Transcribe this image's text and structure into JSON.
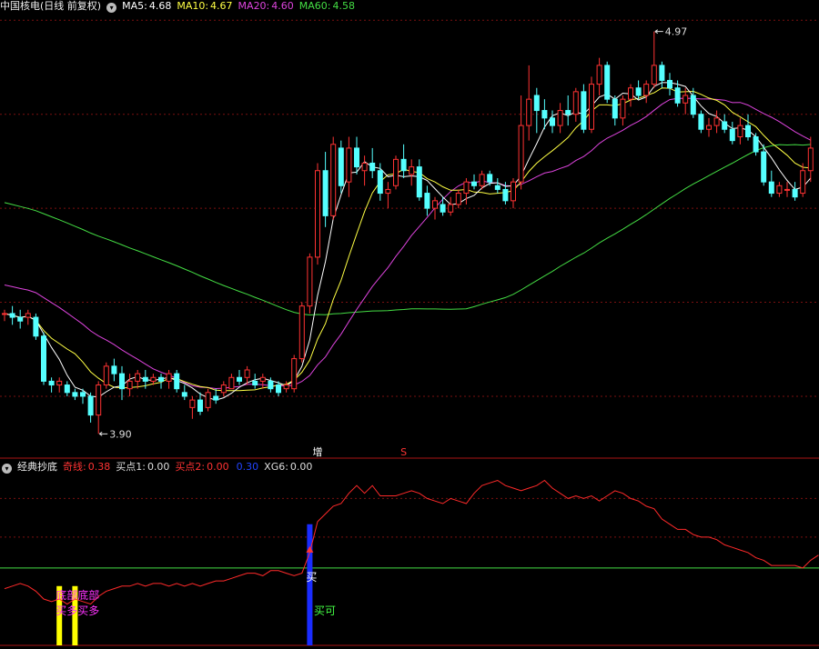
{
  "main_header": {
    "title": "中国核电(日线 前复权)",
    "items": [
      {
        "label": "MA5:",
        "value": "4.68",
        "color": "#ffffff"
      },
      {
        "label": "MA10:",
        "value": "4.67",
        "color": "#ffff44"
      },
      {
        "label": "MA20:",
        "value": "4.60",
        "color": "#dd44dd"
      },
      {
        "label": "MA60:",
        "value": "4.58",
        "color": "#44dd44"
      }
    ]
  },
  "sub_header": {
    "title": "经典抄底",
    "items": [
      {
        "label": "奇线:",
        "value": "0.38",
        "color": "#ff3333"
      },
      {
        "label": "买点1:",
        "value": "0.00",
        "color": "#dddddd"
      },
      {
        "label": "买点2:",
        "value": "0.00",
        "color": "#ff3333"
      },
      {
        "label": "",
        "value": "0.30",
        "color": "#2244ff"
      },
      {
        "label": "XG6:",
        "value": "0.00",
        "color": "#dddddd"
      }
    ]
  },
  "colors": {
    "up": "#ff3333",
    "down": "#55ffff",
    "ma5": "#ffffff",
    "ma10": "#ffff44",
    "ma20": "#dd44dd",
    "ma60": "#44dd44",
    "grid": "#7a1010"
  },
  "chart_data": {
    "type": "candlestick",
    "candles": [
      [
        4.22,
        4.23,
        4.2,
        4.22
      ],
      [
        4.22,
        4.24,
        4.19,
        4.21
      ],
      [
        4.21,
        4.23,
        4.18,
        4.2
      ],
      [
        4.21,
        4.23,
        4.19,
        4.22
      ],
      [
        4.21,
        4.22,
        4.15,
        4.16
      ],
      [
        4.16,
        4.17,
        4.03,
        4.04
      ],
      [
        4.04,
        4.05,
        4.01,
        4.03
      ],
      [
        4.03,
        4.05,
        4.01,
        4.04
      ],
      [
        4.03,
        4.04,
        4.0,
        4.01
      ],
      [
        4.01,
        4.02,
        3.99,
        4.0
      ],
      [
        4.01,
        4.02,
        3.98,
        4.0
      ],
      [
        4.0,
        4.01,
        3.93,
        3.95
      ],
      [
        3.95,
        4.04,
        3.9,
        4.03
      ],
      [
        4.03,
        4.09,
        4.02,
        4.08
      ],
      [
        4.08,
        4.1,
        4.04,
        4.06
      ],
      [
        4.06,
        4.08,
        3.99,
        4.02
      ],
      [
        4.02,
        4.06,
        4.0,
        4.04
      ],
      [
        4.04,
        4.07,
        4.02,
        4.06
      ],
      [
        4.05,
        4.07,
        4.02,
        4.04
      ],
      [
        4.04,
        4.06,
        4.03,
        4.05
      ],
      [
        4.05,
        4.06,
        4.02,
        4.04
      ],
      [
        4.04,
        4.07,
        4.02,
        4.06
      ],
      [
        4.06,
        4.07,
        4.01,
        4.02
      ],
      [
        4.01,
        4.03,
        3.99,
        4.0
      ],
      [
        3.97,
        4.0,
        3.94,
        3.99
      ],
      [
        3.99,
        4.01,
        3.95,
        3.96
      ],
      [
        3.97,
        4.02,
        3.96,
        4.01
      ],
      [
        4.0,
        4.02,
        3.98,
        3.99
      ],
      [
        4.01,
        4.04,
        4.0,
        4.03
      ],
      [
        4.02,
        4.06,
        4.02,
        4.05
      ],
      [
        4.05,
        4.07,
        4.03,
        4.04
      ],
      [
        4.05,
        4.08,
        4.03,
        4.07
      ],
      [
        4.04,
        4.06,
        4.02,
        4.03
      ],
      [
        4.04,
        4.06,
        4.02,
        4.05
      ],
      [
        4.04,
        4.05,
        4.01,
        4.02
      ],
      [
        4.03,
        4.04,
        4.0,
        4.01
      ],
      [
        4.02,
        4.04,
        4.01,
        4.03
      ],
      [
        4.02,
        4.11,
        4.01,
        4.1
      ],
      [
        4.1,
        4.25,
        4.09,
        4.24
      ],
      [
        4.24,
        4.38,
        4.22,
        4.37
      ],
      [
        4.37,
        4.62,
        4.35,
        4.6
      ],
      [
        4.6,
        4.65,
        4.45,
        4.48
      ],
      [
        4.48,
        4.69,
        4.47,
        4.67
      ],
      [
        4.66,
        4.68,
        4.54,
        4.56
      ],
      [
        4.57,
        4.69,
        4.53,
        4.66
      ],
      [
        4.66,
        4.69,
        4.59,
        4.61
      ],
      [
        4.6,
        4.64,
        4.56,
        4.62
      ],
      [
        4.62,
        4.66,
        4.58,
        4.6
      ],
      [
        4.6,
        4.62,
        4.52,
        4.54
      ],
      [
        4.54,
        4.57,
        4.5,
        4.55
      ],
      [
        4.56,
        4.64,
        4.55,
        4.63
      ],
      [
        4.63,
        4.67,
        4.58,
        4.6
      ],
      [
        4.59,
        4.63,
        4.56,
        4.61
      ],
      [
        4.61,
        4.63,
        4.52,
        4.53
      ],
      [
        4.54,
        4.56,
        4.48,
        4.5
      ],
      [
        4.5,
        4.53,
        4.47,
        4.52
      ],
      [
        4.51,
        4.53,
        4.48,
        4.49
      ],
      [
        4.49,
        4.53,
        4.48,
        4.51
      ],
      [
        4.51,
        4.55,
        4.5,
        4.54
      ],
      [
        4.54,
        4.58,
        4.51,
        4.57
      ],
      [
        4.57,
        4.59,
        4.55,
        4.56
      ],
      [
        4.56,
        4.6,
        4.55,
        4.59
      ],
      [
        4.59,
        4.6,
        4.56,
        4.57
      ],
      [
        4.56,
        4.58,
        4.54,
        4.55
      ],
      [
        4.55,
        4.57,
        4.51,
        4.52
      ],
      [
        4.52,
        4.58,
        4.5,
        4.57
      ],
      [
        4.57,
        4.8,
        4.55,
        4.72
      ],
      [
        4.72,
        4.88,
        4.68,
        4.79
      ],
      [
        4.8,
        4.82,
        4.7,
        4.76
      ],
      [
        4.76,
        4.79,
        4.71,
        4.74
      ],
      [
        4.74,
        4.76,
        4.7,
        4.72
      ],
      [
        4.72,
        4.78,
        4.7,
        4.76
      ],
      [
        4.76,
        4.8,
        4.72,
        4.75
      ],
      [
        4.75,
        4.82,
        4.73,
        4.81
      ],
      [
        4.81,
        4.83,
        4.7,
        4.71
      ],
      [
        4.71,
        4.85,
        4.7,
        4.83
      ],
      [
        4.83,
        4.9,
        4.8,
        4.88
      ],
      [
        4.88,
        4.89,
        4.78,
        4.79
      ],
      [
        4.79,
        4.8,
        4.72,
        4.74
      ],
      [
        4.74,
        4.8,
        4.72,
        4.79
      ],
      [
        4.79,
        4.83,
        4.77,
        4.82
      ],
      [
        4.82,
        4.84,
        4.79,
        4.8
      ],
      [
        4.8,
        4.84,
        4.78,
        4.83
      ],
      [
        4.83,
        4.97,
        4.82,
        4.88
      ],
      [
        4.88,
        4.89,
        4.82,
        4.84
      ],
      [
        4.84,
        4.86,
        4.8,
        4.82
      ],
      [
        4.82,
        4.84,
        4.77,
        4.78
      ],
      [
        4.78,
        4.82,
        4.75,
        4.8
      ],
      [
        4.8,
        4.82,
        4.74,
        4.75
      ],
      [
        4.75,
        4.76,
        4.7,
        4.71
      ],
      [
        4.71,
        4.74,
        4.69,
        4.72
      ],
      [
        4.72,
        4.76,
        4.7,
        4.74
      ],
      [
        4.73,
        4.75,
        4.7,
        4.71
      ],
      [
        4.71,
        4.73,
        4.67,
        4.68
      ],
      [
        4.69,
        4.74,
        4.67,
        4.72
      ],
      [
        4.72,
        4.75,
        4.68,
        4.69
      ],
      [
        4.69,
        4.7,
        4.64,
        4.65
      ],
      [
        4.65,
        4.67,
        4.56,
        4.57
      ],
      [
        4.57,
        4.6,
        4.53,
        4.54
      ],
      [
        4.54,
        4.57,
        4.53,
        4.56
      ],
      [
        4.55,
        4.57,
        4.53,
        4.55
      ],
      [
        4.55,
        4.57,
        4.52,
        4.53
      ],
      [
        4.54,
        4.62,
        4.53,
        4.6
      ],
      [
        4.6,
        4.69,
        4.57,
        4.66
      ]
    ],
    "main_ylim": [
      3.85,
      5.02
    ],
    "annotations": [
      {
        "label": "4.97",
        "index": 83,
        "price": 4.97
      },
      {
        "label": "3.90",
        "index": 12,
        "price": 3.9
      }
    ],
    "markers": [
      {
        "label": "增",
        "index": 40,
        "color": "#ffffff"
      },
      {
        "label": "S",
        "index": 51,
        "color": "#ff3333"
      }
    ],
    "indicator": {
      "values": [
        0.1,
        0.11,
        0.12,
        0.11,
        0.09,
        0.06,
        0.05,
        0.06,
        0.04,
        0.06,
        0.05,
        0.04,
        0.07,
        0.09,
        0.1,
        0.11,
        0.11,
        0.12,
        0.11,
        0.12,
        0.12,
        0.11,
        0.12,
        0.11,
        0.12,
        0.11,
        0.12,
        0.13,
        0.13,
        0.14,
        0.15,
        0.16,
        0.16,
        0.15,
        0.17,
        0.17,
        0.16,
        0.15,
        0.16,
        0.24,
        0.36,
        0.39,
        0.42,
        0.43,
        0.47,
        0.5,
        0.47,
        0.5,
        0.46,
        0.46,
        0.46,
        0.47,
        0.48,
        0.47,
        0.45,
        0.44,
        0.43,
        0.45,
        0.44,
        0.43,
        0.47,
        0.5,
        0.51,
        0.52,
        0.5,
        0.49,
        0.48,
        0.49,
        0.5,
        0.52,
        0.49,
        0.47,
        0.45,
        0.46,
        0.45,
        0.46,
        0.44,
        0.46,
        0.48,
        0.47,
        0.45,
        0.44,
        0.42,
        0.41,
        0.37,
        0.35,
        0.33,
        0.33,
        0.31,
        0.3,
        0.3,
        0.29,
        0.27,
        0.26,
        0.25,
        0.24,
        0.22,
        0.21,
        0.19,
        0.19,
        0.19,
        0.19,
        0.18,
        0.21,
        0.23
      ],
      "ylim": [
        -0.12,
        0.55
      ],
      "level": 0.18,
      "yellow_bars": [
        {
          "index": 7,
          "y_from": -0.12,
          "y_to": 0.11
        },
        {
          "index": 9,
          "y_from": -0.12,
          "y_to": 0.11
        }
      ],
      "blue_bar": {
        "index": 39,
        "y_from": -0.12,
        "y_to": 0.35
      },
      "arrow": {
        "index": 39
      },
      "labels": [
        {
          "text": "底部底部",
          "index": 7,
          "value": 0.06,
          "color": "#ff33ff"
        },
        {
          "text": "买多买多",
          "index": 7,
          "value": 0.0,
          "color": "#ff33ff"
        },
        {
          "text": "买",
          "index": 39,
          "value": 0.13,
          "color": "#ffffff"
        },
        {
          "text": "买可",
          "index": 40,
          "value": 0.0,
          "color": "#44ff44"
        }
      ]
    }
  }
}
